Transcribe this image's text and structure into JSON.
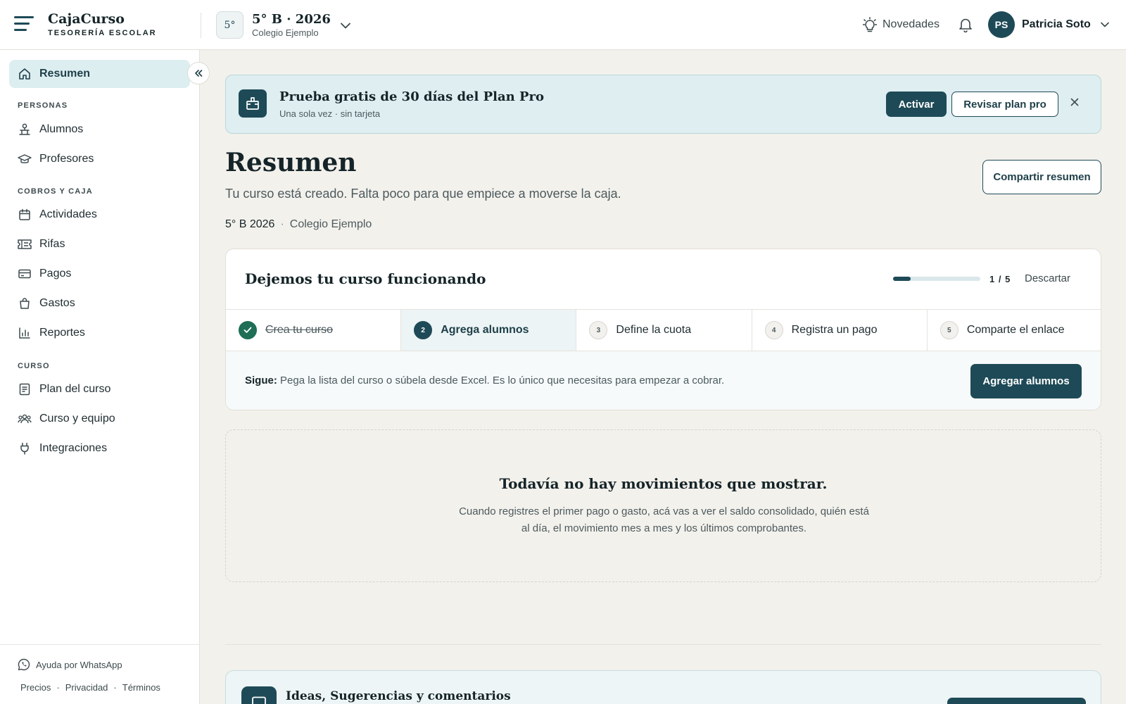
{
  "brand": {
    "name": "CajaCurso",
    "tagline": "TESORERÍA ESCOLAR"
  },
  "course_switcher": {
    "badge": "5°",
    "title": "5° B · 2026",
    "school": "Colegio Ejemplo"
  },
  "header": {
    "news_label": "Novedades",
    "user_initials": "PS",
    "user_name": "Patricia Soto"
  },
  "sidebar": {
    "active": {
      "label": "Resumen",
      "icon": "home-icon"
    },
    "sections": [
      {
        "title": "PERSONAS",
        "items": [
          {
            "label": "Alumnos",
            "icon": "students-icon"
          },
          {
            "label": "Profesores",
            "icon": "graduation-cap-icon"
          }
        ]
      },
      {
        "title": "COBROS Y CAJA",
        "items": [
          {
            "label": "Actividades",
            "icon": "calendar-icon"
          },
          {
            "label": "Rifas",
            "icon": "ticket-icon"
          },
          {
            "label": "Pagos",
            "icon": "card-icon"
          },
          {
            "label": "Gastos",
            "icon": "bag-icon"
          },
          {
            "label": "Reportes",
            "icon": "bar-chart-icon"
          }
        ]
      },
      {
        "title": "CURSO",
        "items": [
          {
            "label": "Plan del curso",
            "icon": "document-icon"
          },
          {
            "label": "Curso y equipo",
            "icon": "team-icon"
          },
          {
            "label": "Integraciones",
            "icon": "plug-icon"
          }
        ]
      }
    ],
    "footer": {
      "whatsapp": "Ayuda por WhatsApp",
      "links": [
        "Precios",
        "Privacidad",
        "Términos"
      ]
    }
  },
  "promo": {
    "title": "Prueba gratis de 30 días del Plan Pro",
    "subtitle": "Una sola vez · sin tarjeta",
    "activate": "Activar",
    "review": "Revisar plan pro"
  },
  "page": {
    "title": "Resumen",
    "subtitle": "Tu curso está creado. Falta poco para que empiece a moverse la caja.",
    "share": "Compartir resumen",
    "course": "5° B 2026",
    "separator": "·",
    "school": "Colegio Ejemplo"
  },
  "onboarding": {
    "title": "Dejemos tu curso funcionando",
    "progress": 0.2,
    "progress_label": "1 / 5",
    "dismiss": "Descartar",
    "steps": [
      {
        "num": "",
        "label": "Crea tu curso",
        "state": "done"
      },
      {
        "num": "2",
        "label": "Agrega alumnos",
        "state": "current"
      },
      {
        "num": "3",
        "label": "Define la cuota",
        "state": "pending"
      },
      {
        "num": "4",
        "label": "Registra un pago",
        "state": "pending"
      },
      {
        "num": "5",
        "label": "Comparte el enlace",
        "state": "pending"
      }
    ],
    "next_prefix": "Sigue:",
    "next_text": "Pega la lista del curso o súbela desde Excel. Es lo único que necesitas para empezar a cobrar.",
    "next_button": "Agregar alumnos"
  },
  "empty_state": {
    "title": "Todavía no hay movimientos que mostrar.",
    "description": "Cuando registres el primer pago o gasto, acá vas a ver el saldo consolidado, quién está al día, el movimiento mes a mes y los últimos comprobantes."
  },
  "ideas": {
    "title": "Ideas, Sugerencias y comentarios"
  },
  "colors": {
    "primary": "#1e4a57",
    "success": "#1f6e56",
    "active_bg": "#ddeef1",
    "page_bg": "#f3f1ec"
  }
}
